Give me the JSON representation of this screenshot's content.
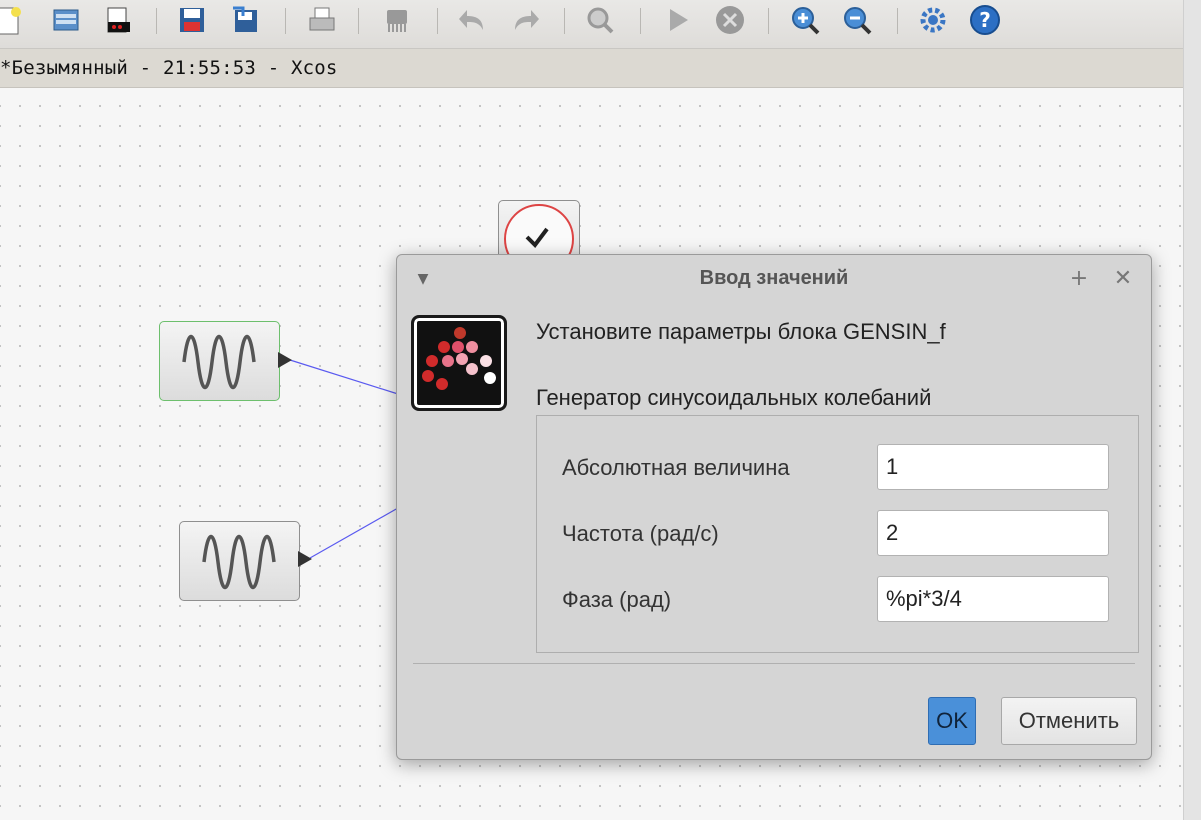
{
  "window": {
    "title": "*Безымянный - 21:55:53 - Xcos"
  },
  "toolbar": {
    "items": [
      "new-diagram-icon",
      "open-icon",
      "open-file-icon",
      "save-icon",
      "save-as-icon",
      "print-icon",
      "delete-icon",
      "undo-icon",
      "redo-icon",
      "fit-zoom-icon",
      "start-icon",
      "stop-icon",
      "zoom-in-icon",
      "zoom-out-icon",
      "settings-icon",
      "help-icon"
    ]
  },
  "dialog": {
    "title": "Ввод значений",
    "prompt": "Установите параметры блока GENSIN_f",
    "group_title": "Генератор синусоидальных колебаний",
    "fields": [
      {
        "label": "Абсолютная величина",
        "value": "1"
      },
      {
        "label": "Частота (рад/с)",
        "value": "2"
      },
      {
        "label": "Фаза (рад)",
        "value": "%pi*3/4"
      }
    ],
    "ok_label": "OK",
    "cancel_label": "Отменить"
  },
  "colors": {
    "link": "#5a5af0",
    "selected": "#6dbf6d",
    "accent": "#4a90d9"
  }
}
